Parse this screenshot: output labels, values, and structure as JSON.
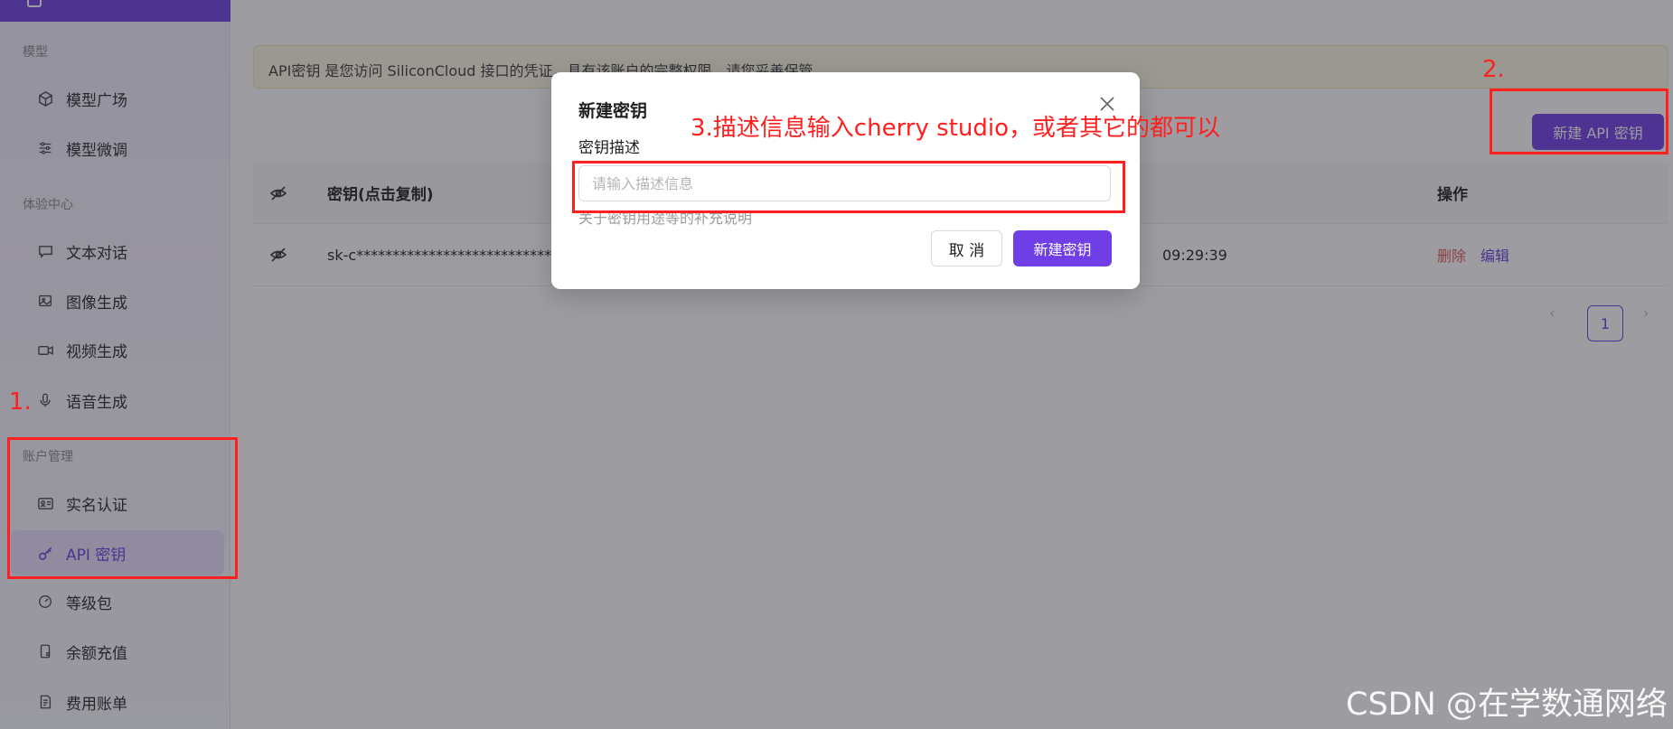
{
  "sidebar": {
    "sections": [
      {
        "label": "模型",
        "items": [
          {
            "label": "模型广场",
            "icon": "cube-icon"
          },
          {
            "label": "模型微调",
            "icon": "sliders-icon"
          }
        ]
      },
      {
        "label": "体验中心",
        "items": [
          {
            "label": "文本对话",
            "icon": "chat-icon"
          },
          {
            "label": "图像生成",
            "icon": "image-icon"
          },
          {
            "label": "视频生成",
            "icon": "video-icon"
          },
          {
            "label": "语音生成",
            "icon": "microphone-icon"
          }
        ]
      },
      {
        "label": "账户管理",
        "items": [
          {
            "label": "实名认证",
            "icon": "id-card-icon"
          },
          {
            "label": "API 密钥",
            "icon": "key-icon",
            "active": true
          },
          {
            "label": "等级包",
            "icon": "gauge-icon"
          },
          {
            "label": "余额充值",
            "icon": "wallet-icon"
          },
          {
            "label": "费用账单",
            "icon": "bill-icon"
          }
        ]
      }
    ]
  },
  "main": {
    "notice": "API密钥 是您访问 SiliconCloud 接口的凭证，具有该账户的完整权限，请您妥善保管。",
    "create_button": "新建 API 密钥",
    "table": {
      "headers": {
        "key": "密钥(点击复制)",
        "actions": "操作"
      },
      "rows": [
        {
          "key": "sk-c******************************",
          "time": "09:29:39",
          "delete": "删除",
          "edit": "编辑"
        }
      ]
    },
    "pagination": {
      "prev": "‹",
      "current": "1",
      "next": "›"
    }
  },
  "modal": {
    "title": "新建密钥",
    "field_label": "密钥描述",
    "input_placeholder": "请输入描述信息",
    "input_value": "",
    "help_text": "关于密钥用途等的补充说明",
    "cancel": "取 消",
    "confirm": "新建密钥"
  },
  "annotations": {
    "step1": "1.",
    "step2": "2.",
    "step3": "3.描述信息输入cherry studio，或者其它的都可以"
  },
  "watermark": "CSDN @在学数通网络",
  "colors": {
    "accent": "#6f3ee6",
    "annotation": "#ff1f1f",
    "danger": "#e35757"
  }
}
